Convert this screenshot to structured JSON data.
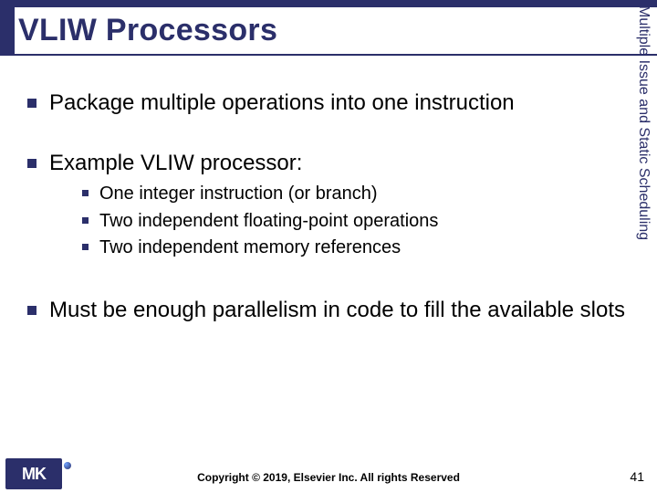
{
  "title": "VLIW Processors",
  "side_label": "Multiple Issue and Static Scheduling",
  "bullets": [
    {
      "text": "Package multiple operations into one instruction",
      "sub": []
    },
    {
      "text": "Example VLIW processor:",
      "sub": [
        "One integer instruction (or branch)",
        "Two independent floating-point operations",
        "Two independent memory references"
      ]
    },
    {
      "text": "Must be enough parallelism in code to fill the available slots",
      "sub": []
    }
  ],
  "logo_text": "MK",
  "copyright": "Copyright © 2019, Elsevier Inc. All rights Reserved",
  "page_number": "41"
}
